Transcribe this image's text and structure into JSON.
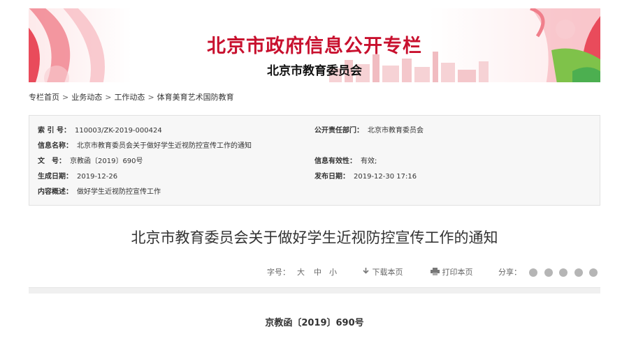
{
  "banner": {
    "title": "北京市政府信息公开专栏",
    "subtitle": "北京市教育委员会"
  },
  "breadcrumb": [
    "专栏首页",
    "业务动态",
    "工作动态",
    "体育美育艺术国防教育"
  ],
  "breadcrumb_sep": ">",
  "meta": {
    "index_label": "索 引 号：",
    "index_value": "110003/ZK-2019-000424",
    "owner_label": "公开责任部门：",
    "owner_value": "北京市教育委员会",
    "name_label": "信息名称：",
    "name_value": "北京市教育委员会关于做好学生近视防控宣传工作的通知",
    "docno_label": "文　号：",
    "docno_value": "京教函〔2019〕690号",
    "validity_label": "信息有效性：",
    "validity_value": "有效;",
    "created_label": "生成日期：",
    "created_value": "2019-12-26",
    "published_label": "发布日期：",
    "published_value": "2019-12-30 17:16",
    "summary_label": "内容概述：",
    "summary_value": "做好学生近视防控宣传工作"
  },
  "document": {
    "title": "北京市教育委员会关于做好学生近视防控宣传工作的通知",
    "number": "京教函〔2019〕690号"
  },
  "toolbar": {
    "font_label": "字号：",
    "font_large": "大",
    "font_medium": "中",
    "font_small": "小",
    "download_label": "下载本页",
    "print_label": "打印本页",
    "share_label": "分享："
  },
  "colors": {
    "title_red": "#c8102e",
    "share_icon": "#b5b5b5"
  }
}
